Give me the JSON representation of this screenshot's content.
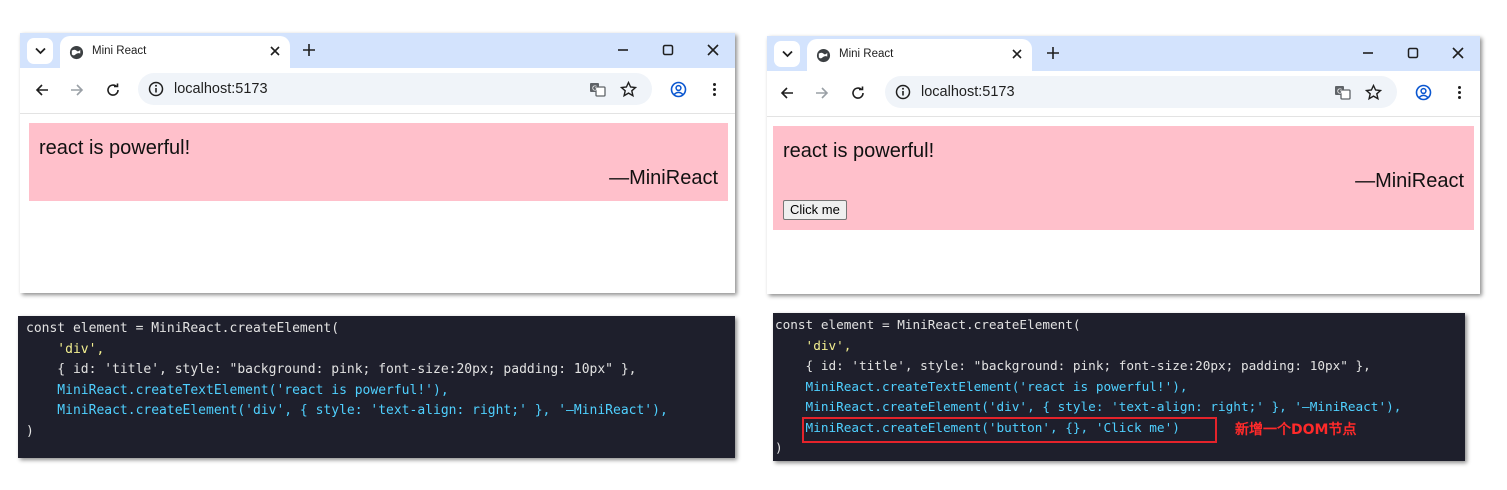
{
  "left": {
    "tab_title": "Mini React",
    "url": "localhost:5173",
    "content_text": "react is powerful!",
    "signature": "—MiniReact",
    "code_lines": [
      "const element = MiniReact.createElement(",
      "    'div',",
      "    { id: 'title', style: \"background: pink; font-size:20px; padding: 10px\" },",
      "    MiniReact.createTextElement('react is powerful!'),",
      "    MiniReact.createElement('div', { style: 'text-align: right;' }, '—MiniReact'),",
      ")"
    ]
  },
  "right": {
    "tab_title": "Mini React",
    "url": "localhost:5173",
    "content_text": "react is powerful!",
    "signature": "—MiniReact",
    "button_label": "Click me",
    "annotation": "新增一个DOM节点",
    "code_lines": [
      "const element = MiniReact.createElement(",
      "    'div',",
      "    { id: 'title', style: \"background: pink; font-size:20px; padding: 10px\" },",
      "    MiniReact.createTextElement('react is powerful!'),",
      "    MiniReact.createElement('div', { style: 'text-align: right;' }, '—MiniReact'),",
      "    MiniReact.createElement('button', {}, 'Click me')",
      ")"
    ]
  },
  "icons": {
    "tab_dropdown": "chevron-down-icon",
    "favicon": "globe-icon",
    "tab_close": "close-icon",
    "new_tab": "plus-icon",
    "minimize": "minimize-icon",
    "maximize": "maximize-icon",
    "window_close": "close-icon",
    "back": "arrow-left-icon",
    "forward": "arrow-right-icon",
    "reload": "reload-icon",
    "site_info": "info-icon",
    "translate": "translate-icon",
    "bookmark": "star-icon",
    "profile": "profile-icon",
    "menu": "more-vertical-icon"
  },
  "colors": {
    "tabbar": "#d3e3fd",
    "pink": "#ffc0cb",
    "code_bg": "#1e1f2c",
    "highlight": "#e4232b"
  }
}
